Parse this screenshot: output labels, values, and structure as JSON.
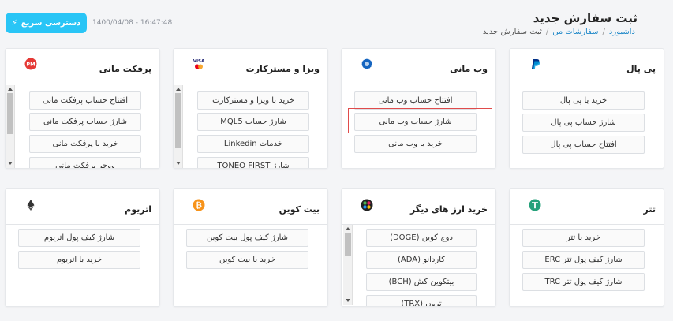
{
  "header": {
    "title": "ثبت سفارش جدید",
    "breadcrumb": [
      "داشبورد",
      "سفارشات من",
      "ثبت سفارش جدید"
    ],
    "quick_access": "دسترسی سریع",
    "datetime": "1400/04/08 - 16:47:48"
  },
  "cards": {
    "perfectmoney": {
      "title": "پرفکت مانی",
      "icon": "perfect-money-icon",
      "buttons": [
        "افتتاح حساب پرفکت مانی",
        "شارژ حساب پرفکت مانی",
        "خرید با پرفکت مانی",
        "ووچر پرفکت مانی"
      ]
    },
    "visa": {
      "title": "ویزا و مسترکارت",
      "icon": "visa-mastercard-icon",
      "buttons": [
        "خرید با ویزا و مسترکارت",
        "شارژ حساب MQL5",
        "خدمات Linkedin",
        "شارژ TONEO FIRST"
      ]
    },
    "webmoney": {
      "title": "وب مانی",
      "icon": "webmoney-icon",
      "buttons": [
        "افتتاح حساب وب مانی",
        "شارژ حساب وب مانی",
        "خرید با وب مانی"
      ]
    },
    "paypal": {
      "title": "پی پال",
      "icon": "paypal-icon",
      "buttons": [
        "خرید با پی پال",
        "شارژ حساب پی پال",
        "افتتاح حساب پی پال"
      ]
    },
    "ethereum": {
      "title": "اتریوم",
      "icon": "ethereum-icon",
      "buttons": [
        "شارژ کیف پول اتریوم",
        "خرید با اتریوم"
      ]
    },
    "bitcoin": {
      "title": "بیت کوین",
      "icon": "bitcoin-icon",
      "buttons": [
        "شارژ کیف پول بیت کوین",
        "خرید با بیت کوین"
      ]
    },
    "othercrypto": {
      "title": "خرید ارز های دیگر",
      "icon": "crypto-icon",
      "buttons": [
        "دوج کوین (DOGE)",
        "کاردانو (ADA)",
        "بیتکوین کش (BCH)",
        "ترون (TRX)"
      ]
    },
    "tether": {
      "title": "تتر",
      "icon": "tether-icon",
      "buttons": [
        "خرید با تتر",
        "شارژ کیف پول تتر ERC",
        "شارژ کیف پول تتر TRC"
      ]
    }
  },
  "colors": {
    "accent": "#29c5f6",
    "highlight": "#e04b4b"
  }
}
